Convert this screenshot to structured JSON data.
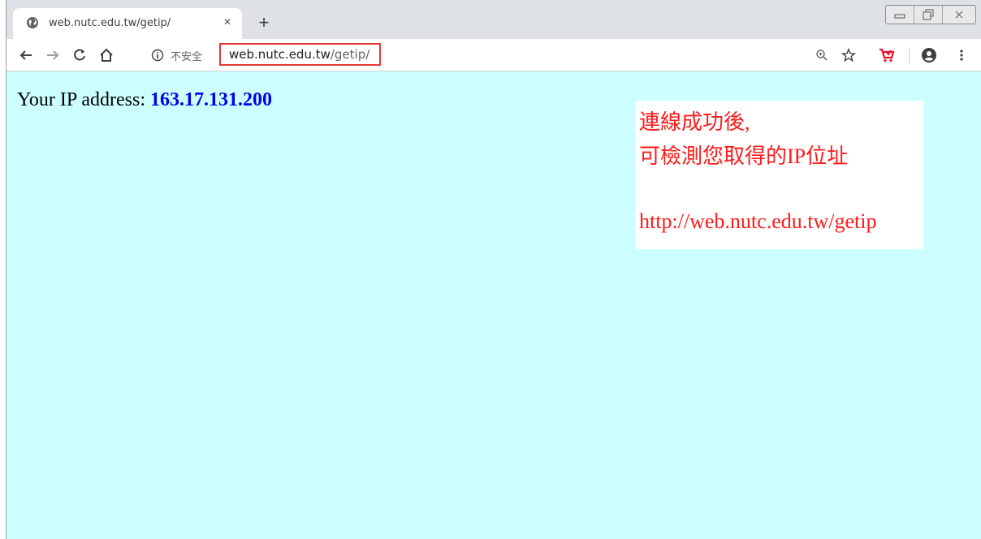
{
  "tab": {
    "title": "web.nutc.edu.tw/getip/",
    "close_glyph": "×",
    "favicon": "globe-icon"
  },
  "new_tab_glyph": "+",
  "window_controls": [
    "minimize-icon",
    "restore-icon",
    "close-icon"
  ],
  "toolbar": {
    "back": "arrow-left-icon",
    "forward": "arrow-right-icon",
    "reload": "reload-icon",
    "home": "home-icon",
    "security_label": "不安全",
    "url_host": "web.nutc.edu.tw",
    "url_path": "/getip/",
    "right_icons": [
      "zoom-icon",
      "star-icon",
      "extension-cart-icon",
      "account-icon",
      "menu-icon"
    ]
  },
  "page": {
    "ip_label": "Your IP address: ",
    "ip_value": "163.17.131.200",
    "note_line1": "連線成功後,",
    "note_line2": "可檢測您取得的IP位址",
    "note_line3": "http://web.nutc.edu.tw/getip"
  },
  "colors": {
    "content_bg": "#ccffff",
    "ip_value": "#0000ee",
    "note_text": "#ff1a1a",
    "url_highlight": "#e53935"
  }
}
